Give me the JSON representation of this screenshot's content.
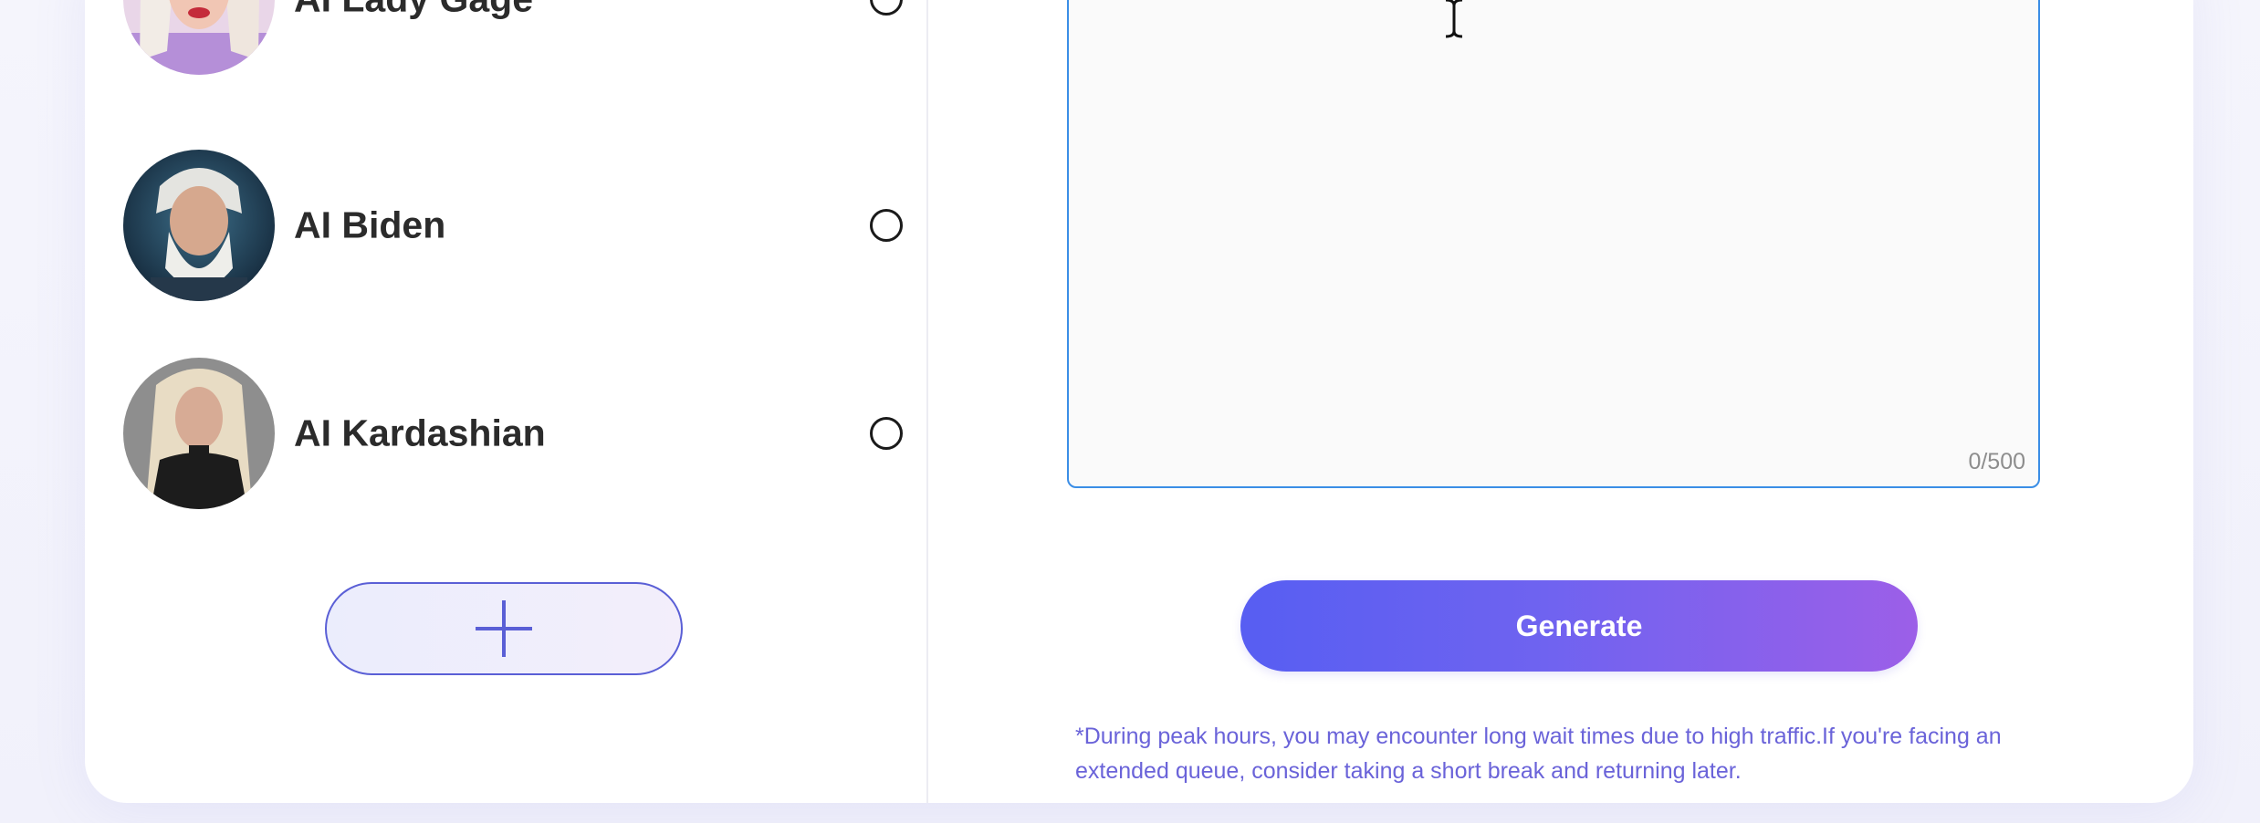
{
  "voices": [
    {
      "name": "AI Lady Gage",
      "avatar_icon": "portrait-blonde-woman"
    },
    {
      "name": "AI Biden",
      "avatar_icon": "portrait-old-man-white-beard"
    },
    {
      "name": "AI Kardashian",
      "avatar_icon": "portrait-woman-long-hair-black-top"
    }
  ],
  "add_voice_icon": "plus-icon",
  "editor": {
    "value": "",
    "char_count": "0/500"
  },
  "generate_label": "Generate",
  "notice": "*During peak hours, you may encounter long wait times due to high traffic.If you're facing an extended queue, consider taking a short break and returning later.",
  "colors": {
    "accent": "#5a5fd6",
    "gradient_start": "#575ef2",
    "gradient_end": "#9c5fe8",
    "textarea_border": "#3b8ee6",
    "notice_text": "#6a63d9"
  }
}
